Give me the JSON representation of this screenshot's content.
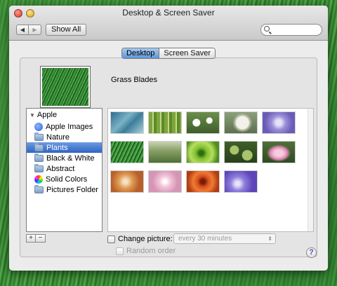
{
  "window": {
    "title": "Desktop & Screen Saver"
  },
  "toolbar": {
    "back_label": "◀",
    "forward_label": "▶",
    "show_all_label": "Show All",
    "search_placeholder": ""
  },
  "tabs": [
    {
      "label": "Desktop",
      "active": true
    },
    {
      "label": "Screen Saver",
      "active": false
    }
  ],
  "preview": {
    "name": "Grass Blades"
  },
  "sidebar": {
    "group": "Apple",
    "items": [
      {
        "label": "Apple Images",
        "icon": "apple-icon"
      },
      {
        "label": "Nature",
        "icon": "folder-icon"
      },
      {
        "label": "Plants",
        "icon": "folder-icon",
        "selected": true
      },
      {
        "label": "Black & White",
        "icon": "folder-icon"
      },
      {
        "label": "Abstract",
        "icon": "folder-icon"
      },
      {
        "label": "Solid Colors",
        "icon": "color-wheel-icon"
      },
      {
        "label": "Pictures Folder",
        "icon": "folder-icon"
      }
    ],
    "add_label": "+",
    "remove_label": "−"
  },
  "thumbnails": [
    "agave",
    "bamboo",
    "daisies",
    "dandelion",
    "purple-flower",
    "grass",
    "meadow",
    "green-swirl",
    "leaves",
    "pink-lotus",
    "orange-petals",
    "pink-thistle",
    "red-rose",
    "purple-petals"
  ],
  "options": {
    "change_picture_label": "Change picture:",
    "interval_value": "every 30 minutes",
    "random_order_label": "Random order",
    "help_label": "?"
  }
}
